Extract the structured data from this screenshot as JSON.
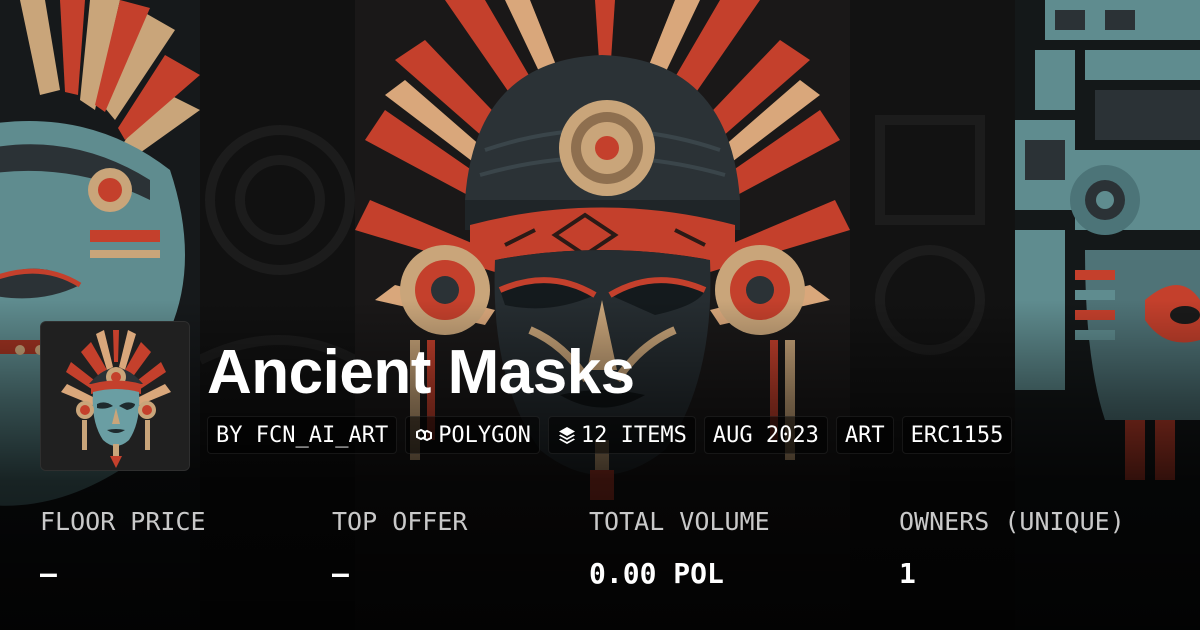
{
  "collection": {
    "title": "Ancient Masks",
    "tags": [
      {
        "text": "BY FCN_AI_ART",
        "icon": ""
      },
      {
        "text": "POLYGON",
        "icon": "polygon-icon"
      },
      {
        "text": "12 ITEMS",
        "icon": "layers-icon"
      },
      {
        "text": "AUG 2023",
        "icon": ""
      },
      {
        "text": "ART",
        "icon": ""
      },
      {
        "text": "ERC1155",
        "icon": ""
      }
    ]
  },
  "stats": [
    {
      "label": "FLOOR PRICE",
      "value": "–"
    },
    {
      "label": "TOP OFFER",
      "value": "–"
    },
    {
      "label": "TOTAL VOLUME",
      "value": "0.00 POL"
    },
    {
      "label": "OWNERS (UNIQUE)",
      "value": "1"
    }
  ],
  "colors": {
    "mask_red": "#c4402c",
    "mask_teal": "#5f8c8f",
    "mask_gold": "#c9a57a",
    "mask_dark": "#2b3236"
  }
}
